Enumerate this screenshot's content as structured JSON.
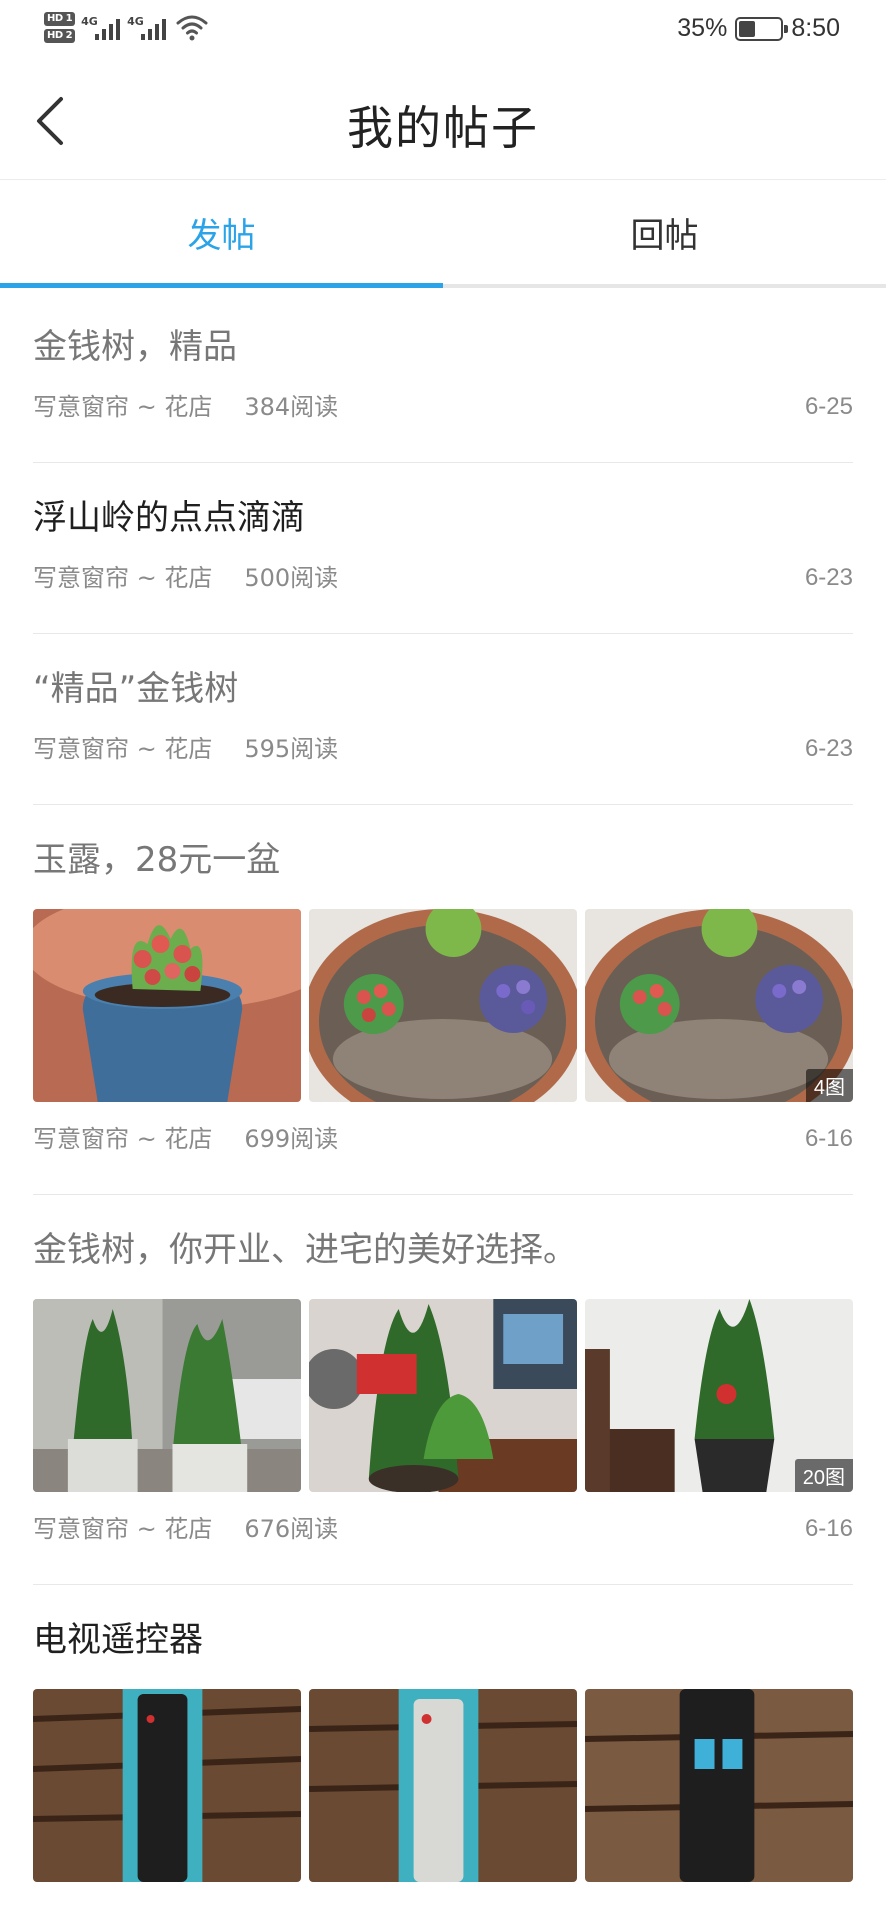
{
  "status_bar": {
    "hd1": "HD 1",
    "hd2": "HD 2",
    "network1": "4G",
    "network2": "4G",
    "battery_percent": "35%",
    "battery_level": 0.35,
    "time": "8:50"
  },
  "header": {
    "back_icon": "chevron-left-icon",
    "title": "我的帖子"
  },
  "tabs": [
    {
      "label": "发帖",
      "active": true
    },
    {
      "label": "回帖",
      "active": false
    }
  ],
  "accent_color": "#2aa3e8",
  "posts": [
    {
      "title": "金钱树，精品",
      "author": "写意窗帘 ~ 花店",
      "reads": "384阅读",
      "date": "6-25"
    },
    {
      "title": "浮山岭的点点滴滴",
      "author": "写意窗帘 ~ 花店",
      "reads": "500阅读",
      "date": "6-23"
    },
    {
      "title": "“精品”金钱树",
      "author": "写意窗帘 ~ 花店",
      "reads": "595阅读",
      "date": "6-23"
    },
    {
      "title": "玉露，28元一盆",
      "author": "写意窗帘 ~ 花店",
      "reads": "699阅读",
      "date": "6-16",
      "image_count": "4图"
    },
    {
      "title": "金钱树，你开业、进宅的美好选择。",
      "author": "写意窗帘 ~ 花店",
      "reads": "676阅读",
      "date": "6-16",
      "image_count": "20图"
    },
    {
      "title": "电视遥控器"
    }
  ]
}
